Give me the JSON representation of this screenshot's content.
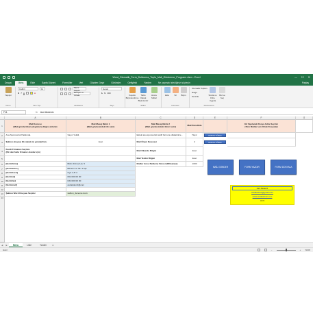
{
  "window": {
    "title": "Word_Otomatik_Form_Doldurma_Toplu_Mail_Gönderme_Programı.xlsm - Excel",
    "controls": [
      "—",
      "☐",
      "✕"
    ]
  },
  "tabs": [
    "Dosya",
    "Giriş",
    "Ekle",
    "Sayfa Düzeni",
    "Formüller",
    "Veri",
    "Gözden Geçir",
    "Görünüm",
    "Geliştirici",
    "Yardım"
  ],
  "tell_me": "Ne yapmak istediğinizi söyleyin",
  "share": "Paylaş",
  "ribbon": {
    "paste": "Yapıştır",
    "clipboard": "Pano",
    "font_name": "Calibri",
    "font_size": "11",
    "font_group": "Yazı Tipi",
    "wrap": "Metni Kaydır",
    "merge": "Birleştir ve Ortala",
    "align_group": "Hizalama",
    "number_format": "Genel",
    "number_group": "Sayı",
    "cond": "Koşullu Biçimlendirme",
    "table": "Tablo Olarak Biçimlendir",
    "styles": "Hücre Stilleri",
    "styles_group": "Stiller",
    "insert": "Ekle",
    "delete": "Sil",
    "format": "Biçim",
    "cells_group": "Hücreler",
    "autosum": "Otomatik Toplam",
    "fill": "Dolgu",
    "clear": "Temizle",
    "sort": "Sırala ve Filtre Uygula",
    "find": "Bul ve Seç",
    "edit_group": "Düzenleme"
  },
  "formula_bar": {
    "name_box": "F11",
    "fx": "fx",
    "content": "Asri Akdeniz"
  },
  "columns": [
    "A",
    "B",
    "C",
    "D",
    "E",
    "F",
    "G"
  ],
  "rows": [
    "1",
    "2",
    "3",
    "4",
    "5",
    "6",
    "7",
    "8",
    "9",
    "10",
    "11",
    "12",
    "13",
    "14"
  ],
  "cells": {
    "a1": "Mail Konusu\n(Mail gönderirken {degisken} bilgisi eklenir)",
    "b1": "Mail Mesaj Metni 1\n(Mail gövdesindeki ilk satır)",
    "c1": "Mail Mesaj Metni 2\n(Mail gövdesindeki ikinci satır)",
    "d1": "Mail İmza Ekle",
    "e1": "",
    "f1": "Ek Yapılacak Dosya Adını Seçiniz\n(Tüm Mailler için Ortak Dosyalar)",
    "a2": "Ana Sponsorluk Hakkında.",
    "b2": "Sayın Yetkili,",
    "c2": "Ekteki ana sponsorluk teklif formunu dikkatinize...",
    "d2": "Hayır",
    "a3": "Şablon dosyası Ek olarak mı gönderilsin.",
    "b3": "Evet",
    "c3": "Mail Önem Derecesi",
    "d3": "2",
    "c4": "Mail Okundu Bilgisi",
    "d4": "Evet",
    "a4": "Kendi Firmanızı Seçiniz.\n(Bir den fazla firmanız olanlar için)",
    "c5": "Mail Teslim Bilgisi",
    "d5": "Evet",
    "a6": "[bizimfirma]",
    "b6": "Bizim Firma A.Ş. 5",
    "c6": "Mailler Arası Bekleme Süresi (Milisaniye)",
    "d6": "1000",
    "a7": "[bizimadres]",
    "b7": "Bilmem ne Sk. 4 Apt.",
    "a8": "[bizimilcesi]",
    "b8": "Oya 4 /8 4",
    "a9": "[bizimtel]",
    "b9": "064 000 00 00",
    "a10": "[bizimfax]",
    "b10": "034 000 00 00",
    "a11": "[bizimmail]",
    "b11": "asriakdeniz@com",
    "a13": "Şablon Word Dosyası Seçiniz",
    "b13": "sablon_deneme.docx"
  },
  "buttons": {
    "file_load_1": "DOSYA YÜKLE",
    "file_load_2": "DOSYA YÜKLE",
    "send_mail": "MAİL GÖNDER",
    "form_write": "FORM YAZDIR",
    "form_file": "FORM DOSYALA"
  },
  "credit": {
    "name": "Asri Akdeniz",
    "email": "asriakdeniz@gmail.com",
    "site": "www.asriakdeniz.com",
    "version": "V2.5"
  },
  "sheets": [
    "Menu",
    "Liste",
    "Yardım"
  ],
  "status": {
    "left": "Hazır",
    "zoom": "%100"
  },
  "colors": {
    "excel_green": "#217346",
    "button_blue": "#4472c4",
    "header_salmon": "#fbe3d6",
    "yellow": "#ffff00"
  }
}
